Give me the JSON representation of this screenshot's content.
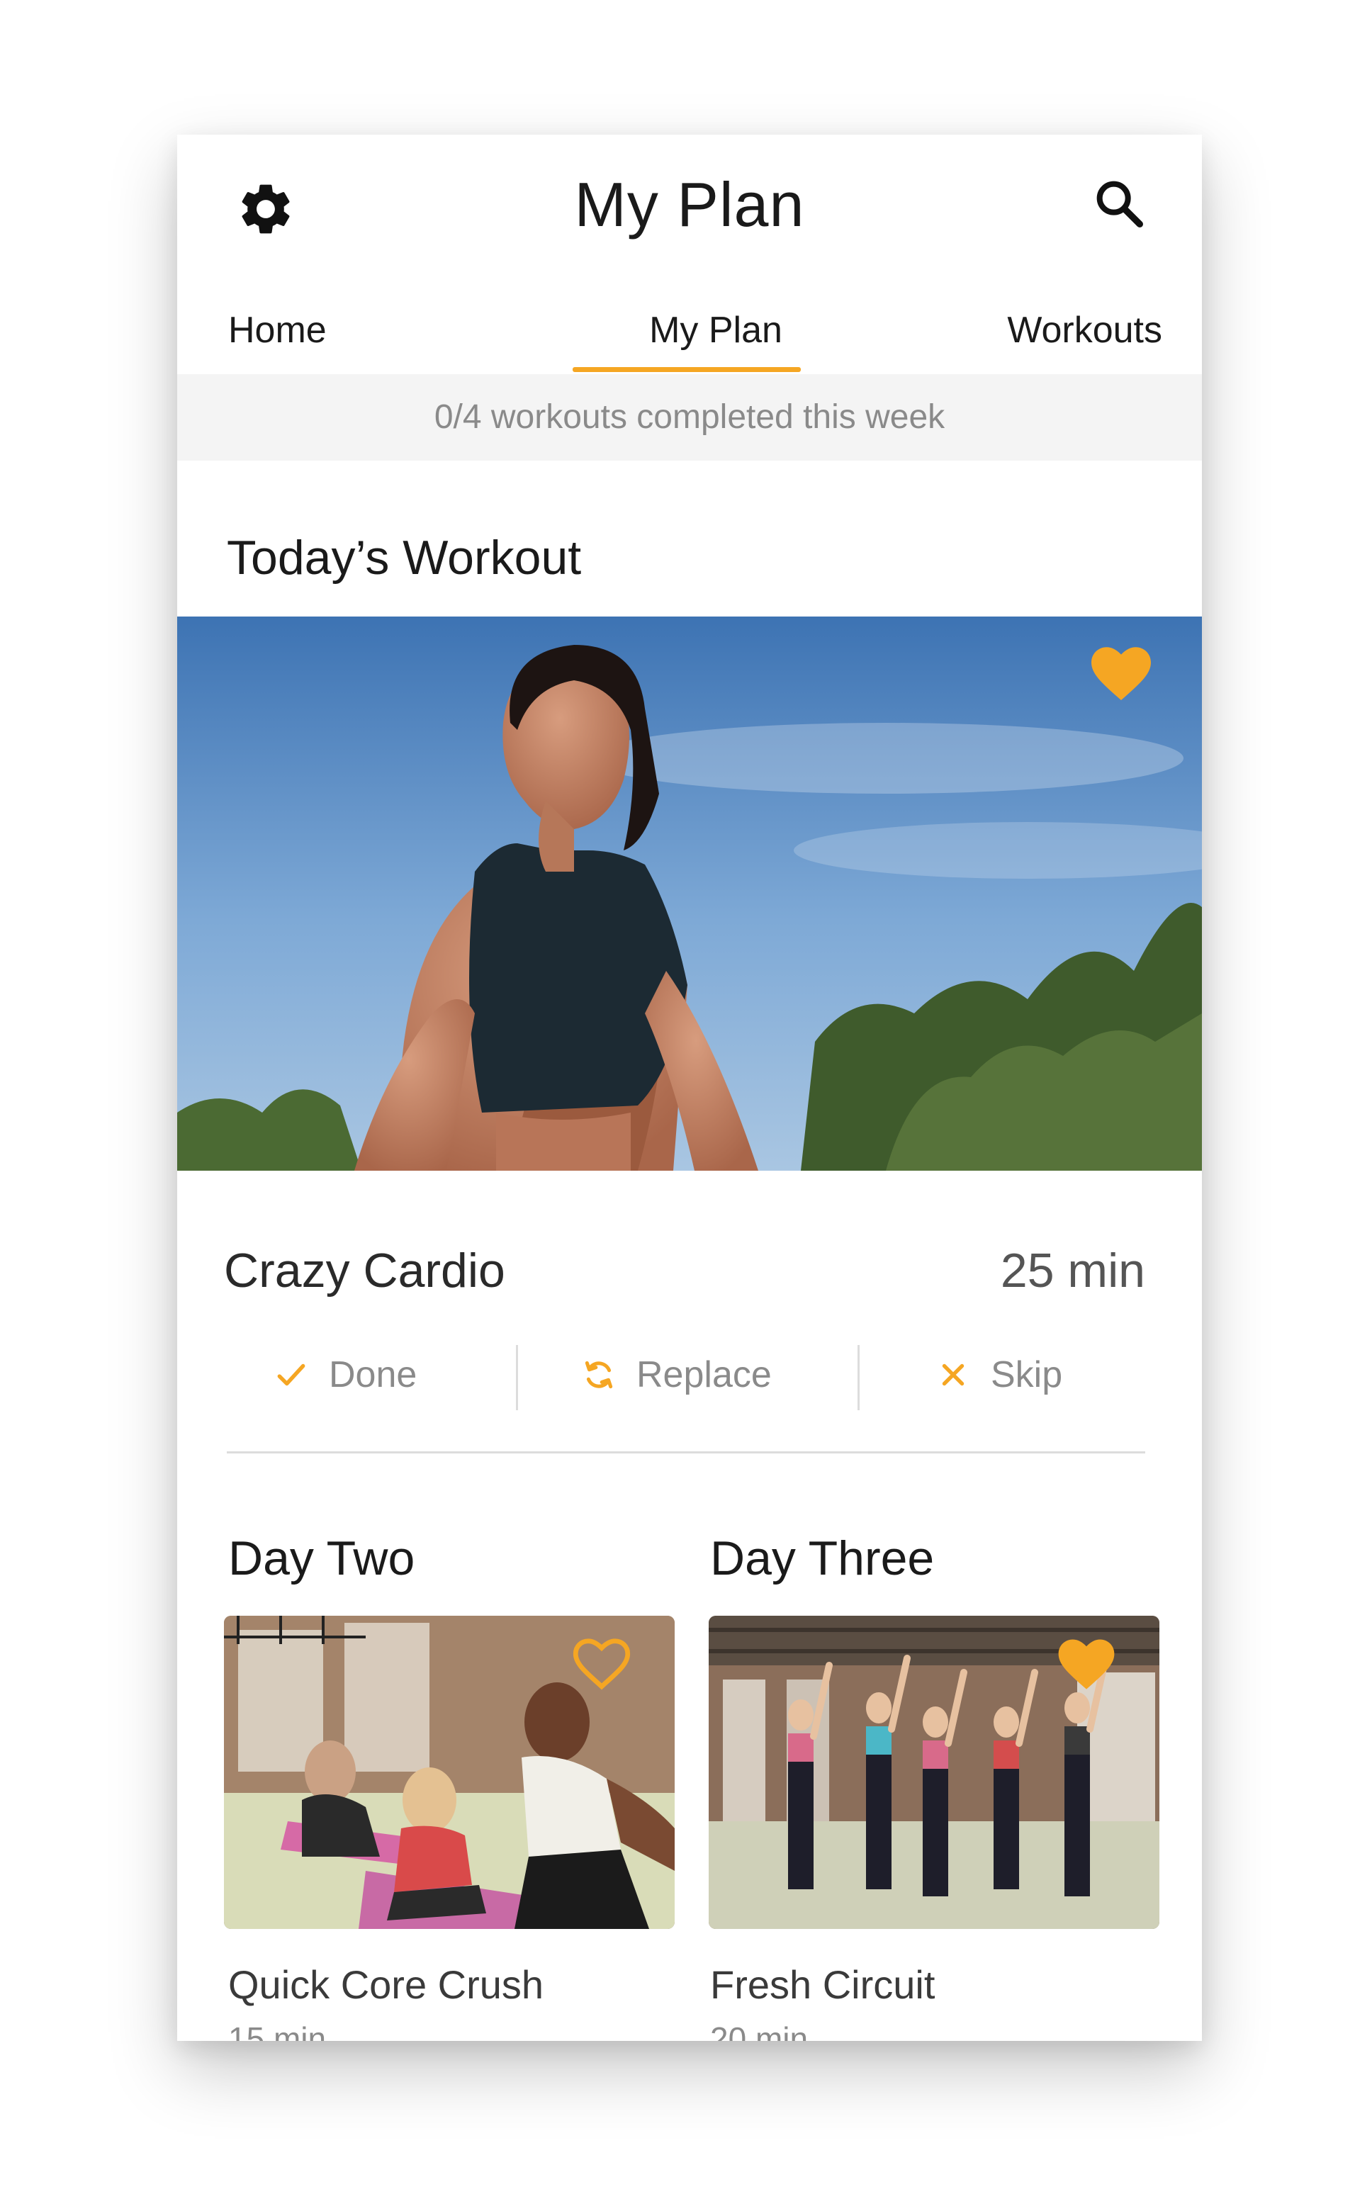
{
  "header": {
    "title": "My Plan",
    "settings_icon": "gear-icon",
    "search_icon": "search-icon"
  },
  "tabs": [
    {
      "label": "Home",
      "selected": false
    },
    {
      "label": "My Plan",
      "selected": true
    },
    {
      "label": "Workouts",
      "selected": false
    }
  ],
  "progress": {
    "text": "0/4 workouts completed this week",
    "completed": 0,
    "total": 4
  },
  "today": {
    "section_title": "Today’s Workout",
    "favorited": true,
    "name": "Crazy Cardio",
    "duration": "25 min",
    "actions": [
      {
        "label": "Done",
        "icon": "check-icon"
      },
      {
        "label": "Replace",
        "icon": "refresh-icon"
      },
      {
        "label": "Skip",
        "icon": "close-icon"
      }
    ]
  },
  "upcoming": [
    {
      "day": "Day Two",
      "name": "Quick Core Crush",
      "duration": "15 min",
      "favorited": false
    },
    {
      "day": "Day Three",
      "name": "Fresh Circuit",
      "duration": "20 min",
      "favorited": true
    }
  ],
  "colors": {
    "accent": "#f5a623",
    "text": "#1a1a1a",
    "muted": "#8a8a8a",
    "progress_bg": "#f4f4f4"
  }
}
